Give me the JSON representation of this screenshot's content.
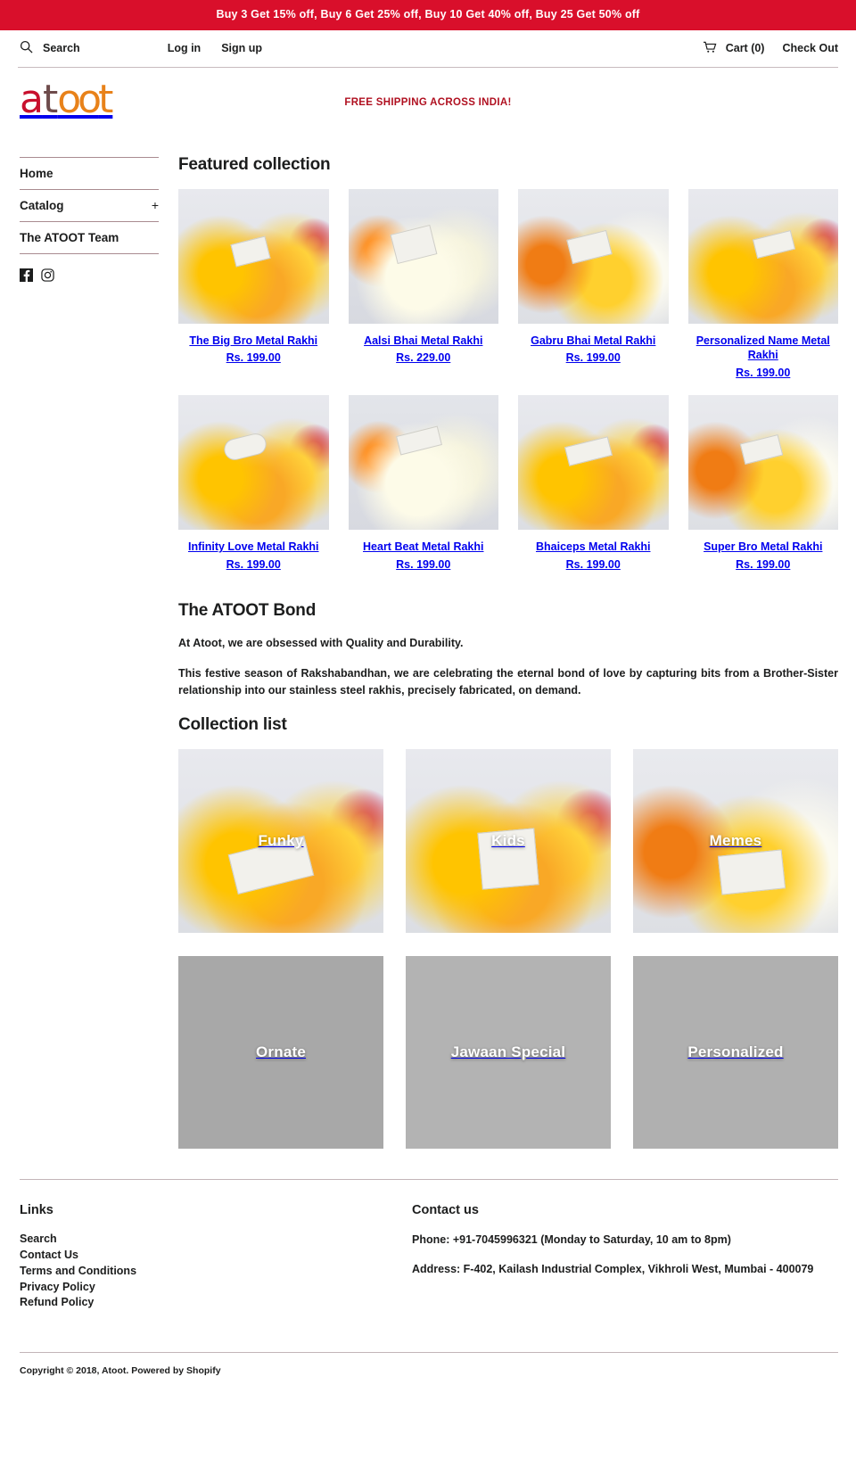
{
  "announcement": "Buy 3 Get 15% off, Buy 6 Get 25% off, Buy 10 Get 40% off, Buy 25 Get 50% off",
  "utility": {
    "search_label": "Search",
    "login_label": "Log in",
    "signup_label": "Sign up",
    "cart_label": "Cart (0)",
    "checkout_label": "Check Out",
    "search_icon": "search-icon",
    "cart_icon": "cart-icon"
  },
  "brand": {
    "logo_text": "atoot",
    "logo_parts": {
      "a": "a",
      "t1": "t",
      "oo": "oo",
      "t2": "t"
    },
    "logo_colors": {
      "a": "#c8102e",
      "t1": "#6e4b4b",
      "oo": "#e8821a",
      "t2": "#e8821a"
    },
    "shipping_banner": "FREE SHIPPING ACROSS INDIA!",
    "shipping_color": "#b01020"
  },
  "sidebar": {
    "items": [
      {
        "label": "Home",
        "expandable": false
      },
      {
        "label": "Catalog",
        "expandable": true,
        "toggle": "+"
      },
      {
        "label": "The ATOOT Team",
        "expandable": false
      }
    ],
    "social": [
      {
        "name": "facebook-icon",
        "label": "Facebook"
      },
      {
        "name": "instagram-icon",
        "label": "Instagram"
      }
    ]
  },
  "featured": {
    "heading": "Featured collection",
    "products": [
      {
        "title": "The Big Bro Metal Rakhi",
        "price": "Rs. 199.00",
        "photo": "fl-y"
      },
      {
        "title": "Aalsi Bhai Metal Rakhi",
        "price": "Rs. 229.00",
        "photo": "fl-w"
      },
      {
        "title": "Gabru Bhai Metal Rakhi",
        "price": "Rs. 199.00",
        "photo": "fl-m"
      },
      {
        "title": "Personalized Name Metal Rakhi",
        "price": "Rs. 199.00",
        "photo": "fl-y"
      },
      {
        "title": "Infinity Love Metal Rakhi",
        "price": "Rs. 199.00",
        "photo": "fl-y"
      },
      {
        "title": "Heart Beat Metal Rakhi",
        "price": "Rs. 199.00",
        "photo": "fl-w"
      },
      {
        "title": "Bhaiceps Metal Rakhi",
        "price": "Rs. 199.00",
        "photo": "fl-y"
      },
      {
        "title": "Super Bro Metal Rakhi",
        "price": "Rs. 199.00",
        "photo": "fl-m"
      }
    ]
  },
  "bond": {
    "heading": "The ATOOT Bond",
    "paragraph1": "At Atoot, we are obsessed with Quality and Durability.",
    "paragraph2": "This festive season of Rakshabandhan, we are celebrating the eternal bond of love by capturing bits from a Brother-Sister relationship into our stainless steel rakhis, precisely fabricated, on demand."
  },
  "collections": {
    "heading": "Collection list",
    "items": [
      {
        "label": "Funky",
        "has_photo": true,
        "photo": "fl-y"
      },
      {
        "label": "Kids",
        "has_photo": true,
        "photo": "fl-y"
      },
      {
        "label": "Memes",
        "has_photo": true,
        "photo": "fl-m"
      },
      {
        "label": "Ornate",
        "has_photo": false,
        "placeholder_color": "#a8a8a8"
      },
      {
        "label": "Jawaan Special",
        "has_photo": false,
        "placeholder_color": "#b3b3b3"
      },
      {
        "label": "Personalized",
        "has_photo": false,
        "placeholder_color": "#b0b0b0"
      }
    ]
  },
  "footer": {
    "links_heading": "Links",
    "links": [
      "Search",
      "Contact Us",
      "Terms and Conditions",
      "Privacy Policy",
      "Refund Policy"
    ],
    "contact_heading": "Contact us",
    "phone": "Phone: +91-7045996321 (Monday to Saturday, 10 am to 8pm)",
    "address": "Address:  F-402, Kailash Industrial Complex, Vikhroli West, Mumbai - 400079",
    "copyright": "Copyright © 2018, Atoot. Powered by Shopify"
  }
}
